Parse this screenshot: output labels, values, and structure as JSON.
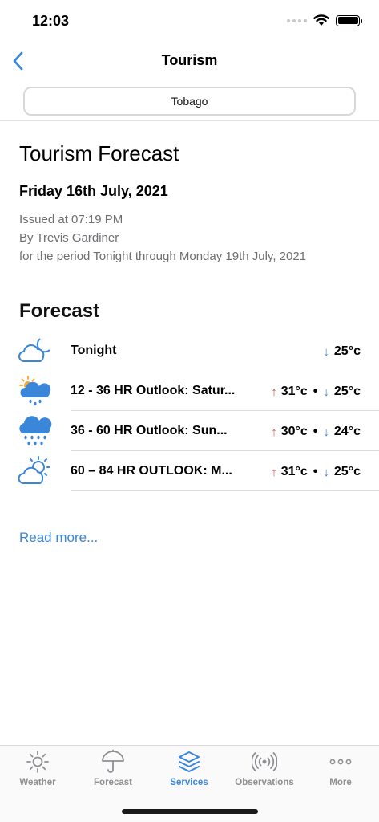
{
  "status": {
    "time": "12:03"
  },
  "nav": {
    "title": "Tourism",
    "back_icon": "chevron-left-icon"
  },
  "location": {
    "selected": "Tobago"
  },
  "report": {
    "heading": "Tourism Forecast",
    "date": "Friday 16th July, 2021",
    "issued": "Issued at 07:19 PM",
    "author": "By Trevis Gardiner",
    "period": "for the period Tonight through Monday 19th July, 2021"
  },
  "forecast": {
    "heading": "Forecast",
    "rows": [
      {
        "label": "Tonight",
        "icon": "cloud-moon-icon",
        "high": "",
        "low": "25°c"
      },
      {
        "label": "12 - 36 HR Outlook: Satur...",
        "icon": "sun-cloud-rain-icon",
        "high": "31°c",
        "low": "25°c"
      },
      {
        "label": "36 - 60 HR Outlook: Sun...",
        "icon": "heavy-rain-icon",
        "high": "30°c",
        "low": "24°c"
      },
      {
        "label": "60 – 84 HR OUTLOOK: M...",
        "icon": "partly-cloudy-icon",
        "high": "31°c",
        "low": "25°c"
      }
    ],
    "sep": "•"
  },
  "read_more": "Read more...",
  "tabs": [
    {
      "label": "Weather",
      "icon": "sun-icon",
      "active": false
    },
    {
      "label": "Forecast",
      "icon": "umbrella-icon",
      "active": false
    },
    {
      "label": "Services",
      "icon": "layers-icon",
      "active": true
    },
    {
      "label": "Observations",
      "icon": "broadcast-icon",
      "active": false
    },
    {
      "label": "More",
      "icon": "more-dots-icon",
      "active": false
    }
  ],
  "colors": {
    "accent": "#3a86d9",
    "up_arrow": "#e04848",
    "down_arrow": "#3a7fcf",
    "muted": "#8e8e93"
  }
}
